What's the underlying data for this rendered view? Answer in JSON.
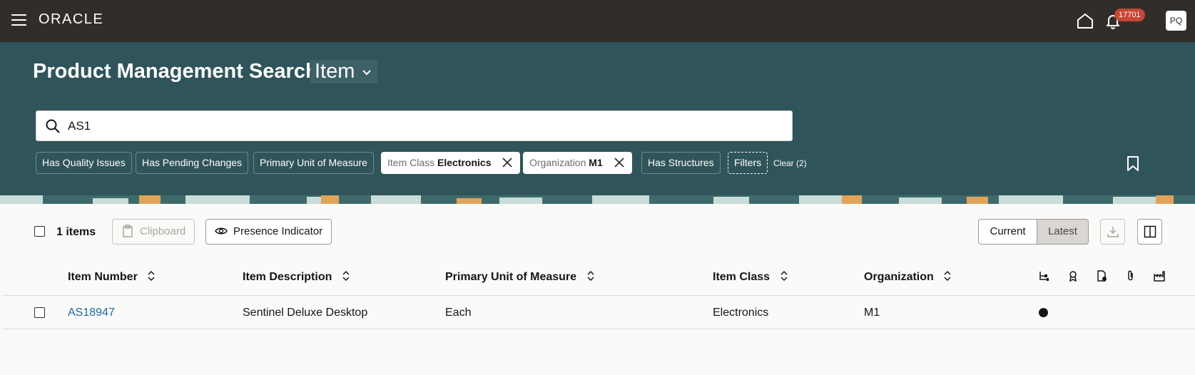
{
  "topbar": {
    "logo": "ORACLE",
    "notification_count": "17701",
    "user_initials": "PQ"
  },
  "header": {
    "title": "Product Management Search",
    "object_type": "Item",
    "search": {
      "value": "AS1",
      "placeholder": ""
    },
    "filters": [
      {
        "label": "Has Quality Issues"
      },
      {
        "label": "Has Pending Changes"
      },
      {
        "label": "Primary Unit of Measure"
      },
      {
        "label": "Item Class",
        "value": "Electronics",
        "selected": true
      },
      {
        "label": "Organization",
        "value": "M1",
        "selected": true
      },
      {
        "label": "Has Structures"
      },
      {
        "label": "Filters"
      }
    ],
    "clear_label": "Clear (2)"
  },
  "toolbar": {
    "items_count": "1 items",
    "clipboard_label": "Clipboard",
    "presence_label": "Presence Indicator",
    "current_label": "Current",
    "latest_label": "Latest"
  },
  "table": {
    "columns": [
      "Item Number",
      "Item Description",
      "Primary Unit of Measure",
      "Item Class",
      "Organization"
    ],
    "icon_columns": [
      "structure-icon",
      "award-icon",
      "document-icon",
      "attachment-icon",
      "factory-icon"
    ],
    "rows": [
      {
        "item_number": "AS18947",
        "description": "Sentinel Deluxe Desktop",
        "uom": "Each",
        "item_class": "Electronics",
        "organization": "M1",
        "has_structure": true
      }
    ]
  },
  "colors": {
    "topbar": "#312d2a",
    "header": "#2f5459",
    "badge": "#c74634",
    "link": "#1a6c9c"
  }
}
